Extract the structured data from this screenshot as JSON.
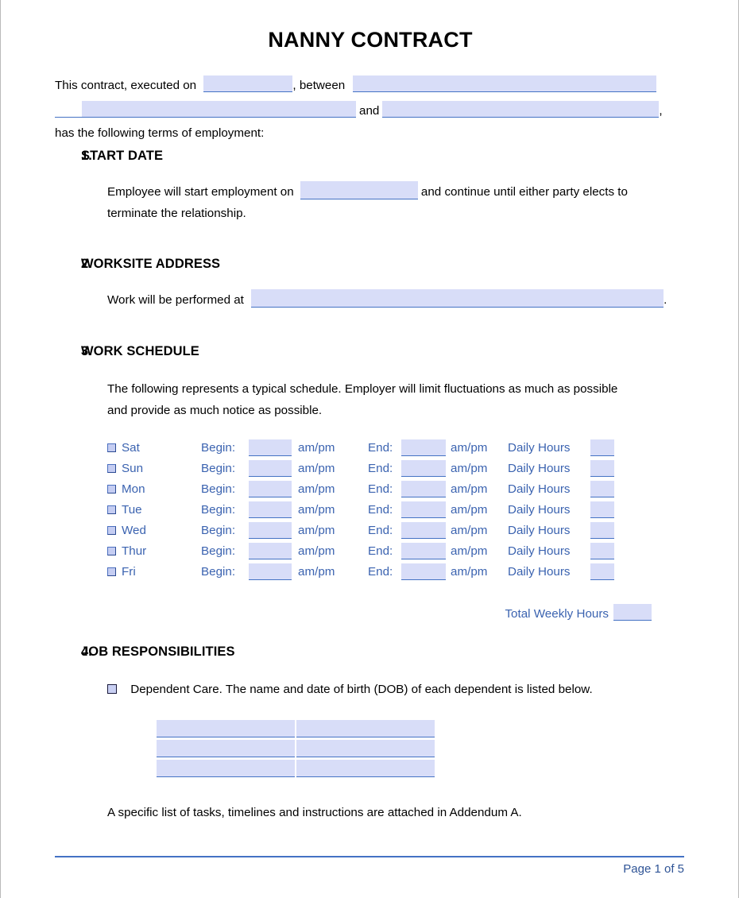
{
  "document": {
    "title": "NANNY CONTRACT",
    "intro": {
      "part1": "This contract, executed on",
      "part2": ", between",
      "part3": "and",
      "part4": ",",
      "part5": "has the following terms of employment:"
    }
  },
  "sections": [
    {
      "number": "1.",
      "title": "START DATE",
      "text_before": "Employee will start employment on",
      "text_after": "and continue until either party elects to",
      "text_line2": "terminate the relationship."
    },
    {
      "number": "2.",
      "title": "WORKSITE ADDRESS",
      "text_before": "Work will be performed at",
      "text_after": "."
    },
    {
      "number": "3.",
      "title": "WORK SCHEDULE",
      "intro_line1": "The following represents a typical schedule. Employer will limit fluctuations as much as possible",
      "intro_line2": "and provide as much notice as possible.",
      "labels": {
        "begin": "Begin:",
        "end": "End:",
        "ampm": "am/pm",
        "daily_hours": "Daily Hours",
        "total_weekly_hours": "Total Weekly Hours"
      },
      "days": [
        {
          "label": "Sat",
          "checked": false,
          "begin": "",
          "begin_ampm": "am/pm",
          "end": "",
          "end_ampm": "am/pm",
          "daily_hours": ""
        },
        {
          "label": "Sun",
          "checked": false,
          "begin": "",
          "begin_ampm": "am/pm",
          "end": "",
          "end_ampm": "am/pm",
          "daily_hours": ""
        },
        {
          "label": "Mon",
          "checked": false,
          "begin": "",
          "begin_ampm": "am/pm",
          "end": "",
          "end_ampm": "am/pm",
          "daily_hours": ""
        },
        {
          "label": "Tue",
          "checked": false,
          "begin": "",
          "begin_ampm": "am/pm",
          "end": "",
          "end_ampm": "am/pm",
          "daily_hours": ""
        },
        {
          "label": "Wed",
          "checked": false,
          "begin": "",
          "begin_ampm": "am/pm",
          "end": "",
          "end_ampm": "am/pm",
          "daily_hours": ""
        },
        {
          "label": "Thur",
          "checked": false,
          "begin": "",
          "begin_ampm": "am/pm",
          "end": "",
          "end_ampm": "am/pm",
          "daily_hours": ""
        },
        {
          "label": "Fri",
          "checked": false,
          "begin": "",
          "begin_ampm": "am/pm",
          "end": "",
          "end_ampm": "am/pm",
          "daily_hours": ""
        }
      ],
      "total_weekly_hours_value": ""
    },
    {
      "number": "4.",
      "title": "JOB RESPONSIBILITIES",
      "dependent_care_label": "Dependent Care. The name and date of birth (DOB) of each dependent is listed below.",
      "dependent_rows": [
        {
          "name": "",
          "dob": ""
        },
        {
          "name": "",
          "dob": ""
        },
        {
          "name": "",
          "dob": ""
        }
      ],
      "closing_text": "A specific list of tasks, timelines and instructions are attached in Addendum A."
    }
  ],
  "fields": {
    "executed_on": "",
    "party_one": "",
    "party_two_line2": "",
    "party_three": "",
    "start_date": "",
    "worksite_address": ""
  },
  "footer": {
    "page_label": "Page 1 of 5"
  },
  "colors": {
    "field_fill": "#d8ddf8",
    "field_border": "#4472c4",
    "accent_text": "#3b63b0",
    "footer_text": "#2f5496",
    "heading_text": "#000000"
  }
}
